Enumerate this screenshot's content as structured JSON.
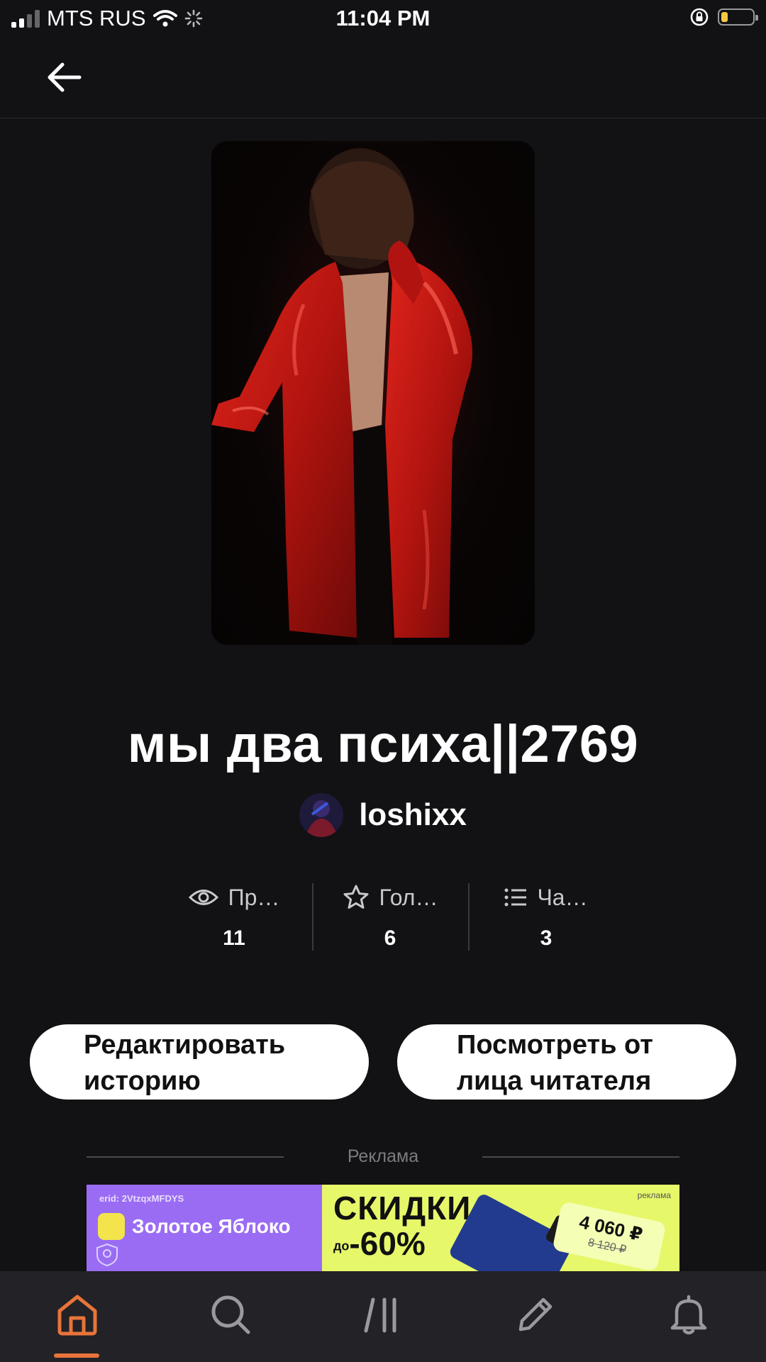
{
  "status_bar": {
    "carrier": "MTS RUS",
    "time": "11:04 PM"
  },
  "story": {
    "title": "мы два психа||2769",
    "author": "loshixx"
  },
  "stats": [
    {
      "label": "Пр…",
      "value": "11",
      "icon": "eye-icon"
    },
    {
      "label": "Гол…",
      "value": "6",
      "icon": "star-icon"
    },
    {
      "label": "Ча…",
      "value": "3",
      "icon": "list-icon"
    }
  ],
  "actions": {
    "edit_label": "Редактировать\nисторию",
    "view_label": "Посмотреть от\nлица читателя"
  },
  "ad": {
    "label": "Реклама",
    "erid": "erid: 2VtzqxMFDYS",
    "brand": "Золотое Яблоко",
    "headline": "СКИДКИ",
    "discount_prefix": "до",
    "discount": "-60%",
    "tag": "реклама",
    "price": "4 060 ₽",
    "old_price": "8 120 ₽"
  },
  "tabbar": {
    "active": "home",
    "active_color": "#e8743a",
    "items": [
      "home-icon",
      "search-icon",
      "library-icon",
      "write-icon",
      "bell-icon"
    ]
  }
}
